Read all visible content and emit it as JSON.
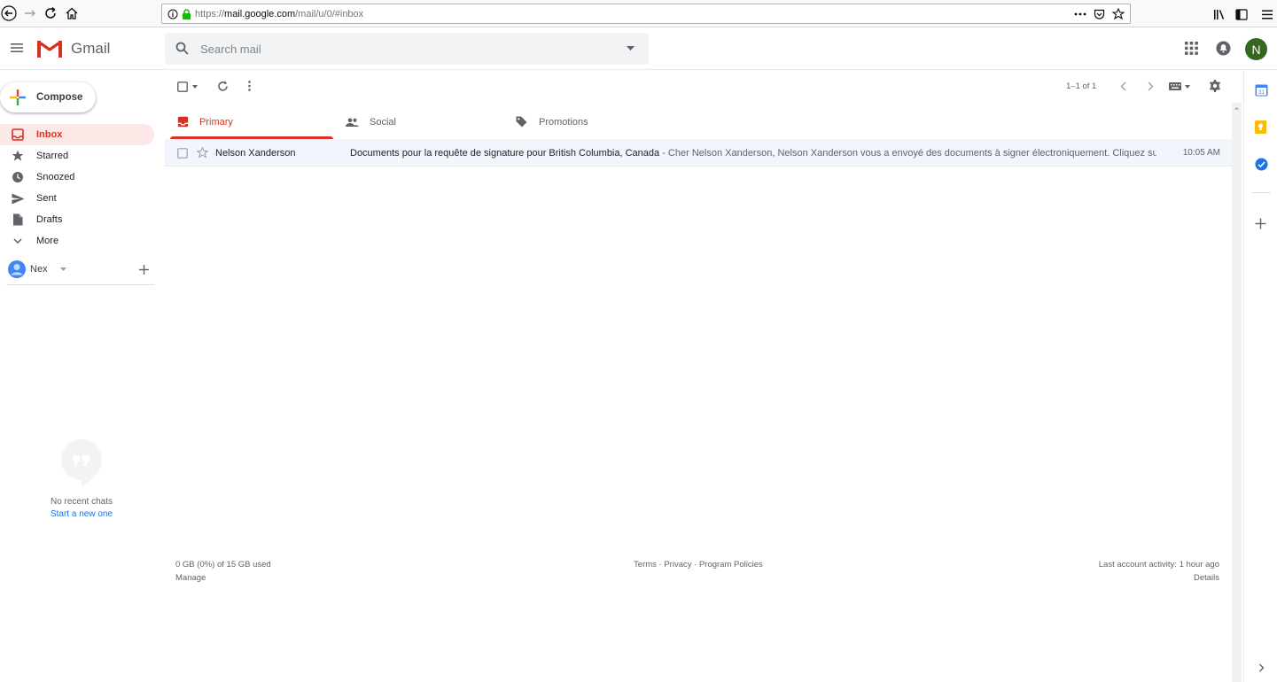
{
  "browser": {
    "url_prefix": "https://",
    "url_domain": "mail.google.com",
    "url_path": "/mail/u/0/#inbox"
  },
  "header": {
    "app_name": "Gmail",
    "search_placeholder": "Search mail",
    "avatar_letter": "N"
  },
  "sidebar": {
    "compose_label": "Compose",
    "items": [
      {
        "label": "Inbox",
        "icon": "inbox-icon",
        "active": true
      },
      {
        "label": "Starred",
        "icon": "star-icon"
      },
      {
        "label": "Snoozed",
        "icon": "clock-icon"
      },
      {
        "label": "Sent",
        "icon": "send-icon"
      },
      {
        "label": "Drafts",
        "icon": "draft-icon"
      },
      {
        "label": "More",
        "icon": "chevron-down-icon"
      }
    ],
    "hangouts_user": "Nex",
    "chat_empty": "No recent chats",
    "chat_start": "Start a new one"
  },
  "toolbar": {
    "pagination": "1–1 of 1"
  },
  "tabs": [
    {
      "label": "Primary",
      "active": true
    },
    {
      "label": "Social"
    },
    {
      "label": "Promotions"
    }
  ],
  "emails": [
    {
      "sender": "Nelson Xanderson",
      "subject": "Documents pour la requête de signature pour British Columbia, Canada",
      "snippet": " - Cher Nelson Xanderson, Nelson Xanderson vous a envoyé des documents à signer électroniquement. Cliquez sur l...",
      "time": "10:05 AM"
    }
  ],
  "footer": {
    "storage": "0 GB (0%) of 15 GB used",
    "manage": "Manage",
    "terms": "Terms",
    "privacy": "Privacy",
    "policies": "Program Policies",
    "separator": " · ",
    "activity": "Last account activity: 1 hour ago",
    "details": "Details"
  },
  "colors": {
    "accent_red": "#d93025",
    "inbox_bg": "#fce8e6",
    "avatar_green": "#33691e",
    "link_blue": "#1a73e8"
  }
}
